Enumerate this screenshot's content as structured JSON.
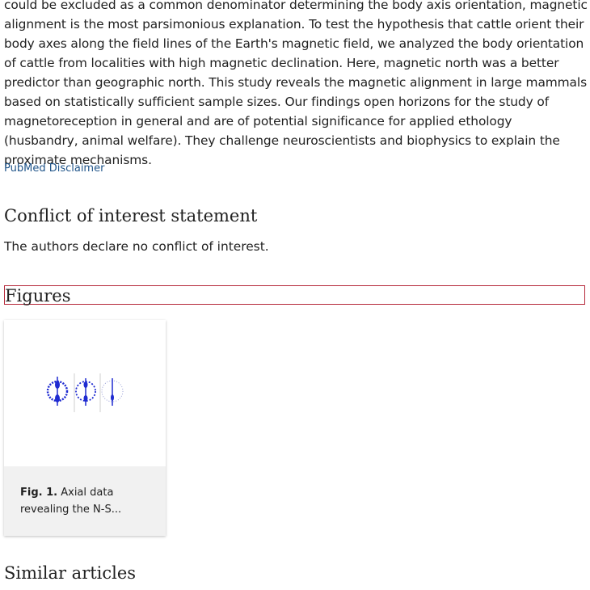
{
  "abstract": {
    "text": "could be excluded as a common denominator determining the body axis orientation, magnetic alignment is the most parsimonious explanation. To test the hypothesis that cattle orient their body axes along the field lines of the Earth's magnetic field, we analyzed the body orientation of cattle from localities with high magnetic declination. Here, magnetic north was a better predictor than geographic north. This study reveals the magnetic alignment in large mammals based on statistically sufficient sample sizes. Our findings open horizons for the study of magnetoreception in general and are of potential significance for applied ethology (husbandry, animal welfare). They challenge neuroscientists and biophysics to explain the proximate mechanisms."
  },
  "disclaimer_link": "PubMed Disclaimer",
  "coi": {
    "heading": "Conflict of interest statement",
    "text": "The authors declare no conflict of interest."
  },
  "figures": {
    "heading": "Figures",
    "items": [
      {
        "label": "Fig. 1.",
        "caption": "Axial data revealing the N-S..."
      }
    ]
  },
  "similar": {
    "heading": "Similar articles"
  },
  "colors": {
    "link": "#20558a",
    "focus_outline": "#b5283a",
    "thumb_plot": "#1f2bd1"
  }
}
